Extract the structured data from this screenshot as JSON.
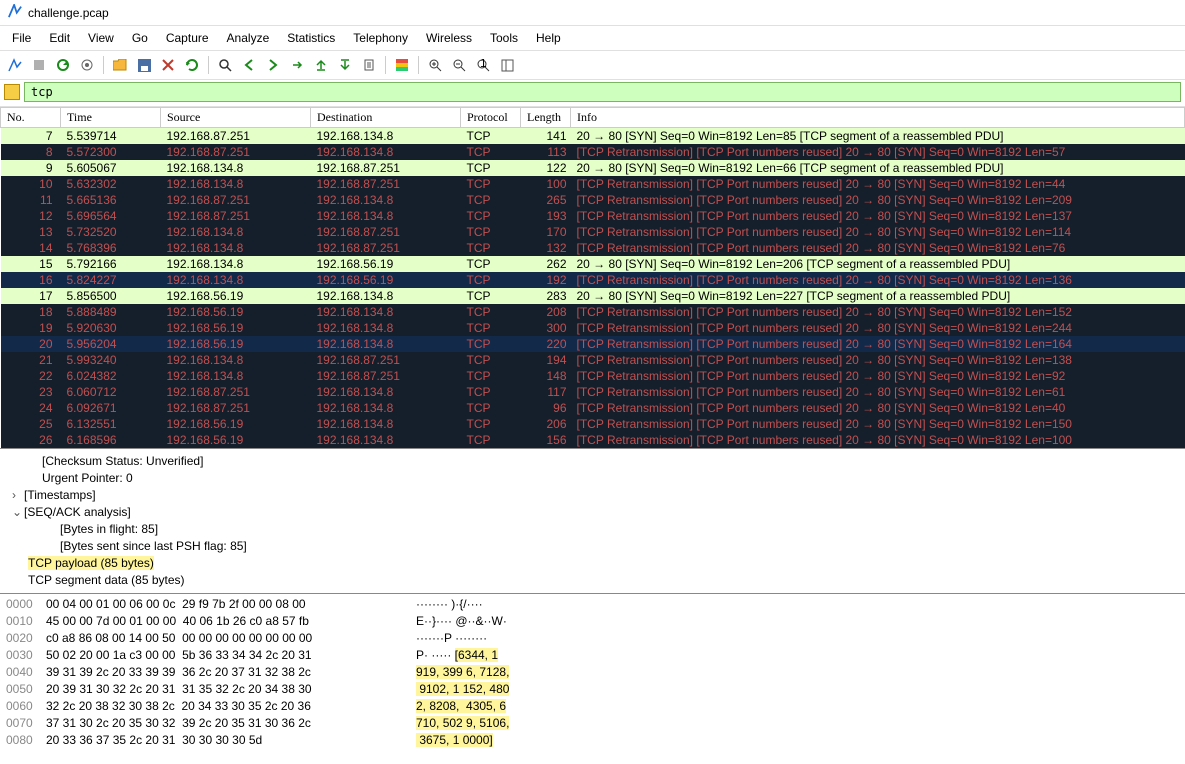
{
  "title": "challenge.pcap",
  "menus": [
    "File",
    "Edit",
    "View",
    "Go",
    "Capture",
    "Analyze",
    "Statistics",
    "Telephony",
    "Wireless",
    "Tools",
    "Help"
  ],
  "filter": "tcp",
  "columns": [
    "No.",
    "Time",
    "Source",
    "Destination",
    "Protocol",
    "Length",
    "Info"
  ],
  "packets": [
    {
      "no": 7,
      "time": "5.539714",
      "src": "192.168.87.251",
      "dst": "192.168.134.8",
      "proto": "TCP",
      "len": 141,
      "info": "20 → 80 [SYN] Seq=0 Win=8192 Len=85 [TCP segment of a reassembled PDU]",
      "cls": "r-ok"
    },
    {
      "no": 8,
      "time": "5.572300",
      "src": "192.168.87.251",
      "dst": "192.168.134.8",
      "proto": "TCP",
      "len": 113,
      "info": "[TCP Retransmission] [TCP Port numbers reused] 20 → 80 [SYN] Seq=0 Win=8192 Len=57",
      "cls": "r-bad"
    },
    {
      "no": 9,
      "time": "5.605067",
      "src": "192.168.134.8",
      "dst": "192.168.87.251",
      "proto": "TCP",
      "len": 122,
      "info": "20 → 80 [SYN] Seq=0 Win=8192 Len=66 [TCP segment of a reassembled PDU]",
      "cls": "r-ok"
    },
    {
      "no": 10,
      "time": "5.632302",
      "src": "192.168.134.8",
      "dst": "192.168.87.251",
      "proto": "TCP",
      "len": 100,
      "info": "[TCP Retransmission] [TCP Port numbers reused] 20 → 80 [SYN] Seq=0 Win=8192 Len=44",
      "cls": "r-bad"
    },
    {
      "no": 11,
      "time": "5.665136",
      "src": "192.168.87.251",
      "dst": "192.168.134.8",
      "proto": "TCP",
      "len": 265,
      "info": "[TCP Retransmission] [TCP Port numbers reused] 20 → 80 [SYN] Seq=0 Win=8192 Len=209",
      "cls": "r-bad"
    },
    {
      "no": 12,
      "time": "5.696564",
      "src": "192.168.87.251",
      "dst": "192.168.134.8",
      "proto": "TCP",
      "len": 193,
      "info": "[TCP Retransmission] [TCP Port numbers reused] 20 → 80 [SYN] Seq=0 Win=8192 Len=137",
      "cls": "r-bad"
    },
    {
      "no": 13,
      "time": "5.732520",
      "src": "192.168.134.8",
      "dst": "192.168.87.251",
      "proto": "TCP",
      "len": 170,
      "info": "[TCP Retransmission] [TCP Port numbers reused] 20 → 80 [SYN] Seq=0 Win=8192 Len=114",
      "cls": "r-bad"
    },
    {
      "no": 14,
      "time": "5.768396",
      "src": "192.168.134.8",
      "dst": "192.168.87.251",
      "proto": "TCP",
      "len": 132,
      "info": "[TCP Retransmission] [TCP Port numbers reused] 20 → 80 [SYN] Seq=0 Win=8192 Len=76",
      "cls": "r-bad"
    },
    {
      "no": 15,
      "time": "5.792166",
      "src": "192.168.134.8",
      "dst": "192.168.56.19",
      "proto": "TCP",
      "len": 262,
      "info": "20 → 80 [SYN] Seq=0 Win=8192 Len=206 [TCP segment of a reassembled PDU]",
      "cls": "r-ok"
    },
    {
      "no": 16,
      "time": "5.824227",
      "src": "192.168.134.8",
      "dst": "192.168.56.19",
      "proto": "TCP",
      "len": 192,
      "info": "[TCP Retransmission] [TCP Port numbers reused] 20 → 80 [SYN] Seq=0 Win=8192 Len=136",
      "cls": "r-badsel"
    },
    {
      "no": 17,
      "time": "5.856500",
      "src": "192.168.56.19",
      "dst": "192.168.134.8",
      "proto": "TCP",
      "len": 283,
      "info": "20 → 80 [SYN] Seq=0 Win=8192 Len=227 [TCP segment of a reassembled PDU]",
      "cls": "r-ok"
    },
    {
      "no": 18,
      "time": "5.888489",
      "src": "192.168.56.19",
      "dst": "192.168.134.8",
      "proto": "TCP",
      "len": 208,
      "info": "[TCP Retransmission] [TCP Port numbers reused] 20 → 80 [SYN] Seq=0 Win=8192 Len=152",
      "cls": "r-bad"
    },
    {
      "no": 19,
      "time": "5.920630",
      "src": "192.168.56.19",
      "dst": "192.168.134.8",
      "proto": "TCP",
      "len": 300,
      "info": "[TCP Retransmission] [TCP Port numbers reused] 20 → 80 [SYN] Seq=0 Win=8192 Len=244",
      "cls": "r-bad"
    },
    {
      "no": 20,
      "time": "5.956204",
      "src": "192.168.56.19",
      "dst": "192.168.134.8",
      "proto": "TCP",
      "len": 220,
      "info": "[TCP Retransmission] [TCP Port numbers reused] 20 → 80 [SYN] Seq=0 Win=8192 Len=164",
      "cls": "r-badsel"
    },
    {
      "no": 21,
      "time": "5.993240",
      "src": "192.168.134.8",
      "dst": "192.168.87.251",
      "proto": "TCP",
      "len": 194,
      "info": "[TCP Retransmission] [TCP Port numbers reused] 20 → 80 [SYN] Seq=0 Win=8192 Len=138",
      "cls": "r-bad"
    },
    {
      "no": 22,
      "time": "6.024382",
      "src": "192.168.134.8",
      "dst": "192.168.87.251",
      "proto": "TCP",
      "len": 148,
      "info": "[TCP Retransmission] [TCP Port numbers reused] 20 → 80 [SYN] Seq=0 Win=8192 Len=92",
      "cls": "r-bad"
    },
    {
      "no": 23,
      "time": "6.060712",
      "src": "192.168.87.251",
      "dst": "192.168.134.8",
      "proto": "TCP",
      "len": 117,
      "info": "[TCP Retransmission] [TCP Port numbers reused] 20 → 80 [SYN] Seq=0 Win=8192 Len=61",
      "cls": "r-bad"
    },
    {
      "no": 24,
      "time": "6.092671",
      "src": "192.168.87.251",
      "dst": "192.168.134.8",
      "proto": "TCP",
      "len": 96,
      "info": "[TCP Retransmission] [TCP Port numbers reused] 20 → 80 [SYN] Seq=0 Win=8192 Len=40",
      "cls": "r-bad"
    },
    {
      "no": 25,
      "time": "6.132551",
      "src": "192.168.56.19",
      "dst": "192.168.134.8",
      "proto": "TCP",
      "len": 206,
      "info": "[TCP Retransmission] [TCP Port numbers reused] 20 → 80 [SYN] Seq=0 Win=8192 Len=150",
      "cls": "r-bad"
    },
    {
      "no": 26,
      "time": "6.168596",
      "src": "192.168.56.19",
      "dst": "192.168.134.8",
      "proto": "TCP",
      "len": 156,
      "info": "[TCP Retransmission] [TCP Port numbers reused] 20 → 80 [SYN] Seq=0 Win=8192 Len=100",
      "cls": "r-bad"
    }
  ],
  "details": {
    "checksum": "[Checksum Status: Unverified]",
    "urgent": "Urgent Pointer: 0",
    "timestamps": "[Timestamps]",
    "seqack": "[SEQ/ACK analysis]",
    "bytes_in_flight": "[Bytes in flight: 85]",
    "bytes_since_psh": "[Bytes sent since last PSH flag: 85]",
    "tcp_payload": "TCP payload (85 bytes)",
    "segment_data": "TCP segment data (85 bytes)"
  },
  "hex": [
    {
      "off": "0000",
      "b": "00 04 00 01 00 06 00 0c  29 f9 7b 2f 00 00 08 00",
      "aplain": "········ )·{/····",
      "ay": ""
    },
    {
      "off": "0010",
      "b": "45 00 00 7d 00 01 00 00  40 06 1b 26 c0 a8 57 fb",
      "aplain": "E··}···· @··&··W·",
      "ay": ""
    },
    {
      "off": "0020",
      "b": "c0 a8 86 08 00 14 00 50  00 00 00 00 00 00 00 00",
      "aplain": "·······P ········",
      "ay": ""
    },
    {
      "off": "0030",
      "b": "50 02 20 00 1a c3 00 00  5b 36 33 34 34 2c 20 31",
      "aplain": "P· ····· ",
      "ay": "[6344, 1"
    },
    {
      "off": "0040",
      "b": "39 31 39 2c 20 33 39 39  36 2c 20 37 31 32 38 2c",
      "aplain": "",
      "ay": "919, 399 6, 7128,"
    },
    {
      "off": "0050",
      "b": "20 39 31 30 32 2c 20 31  31 35 32 2c 20 34 38 30",
      "aplain": "",
      "ay": " 9102, 1 152, 480"
    },
    {
      "off": "0060",
      "b": "32 2c 20 38 32 30 38 2c  20 34 33 30 35 2c 20 36",
      "aplain": "",
      "ay": "2, 8208,  4305, 6"
    },
    {
      "off": "0070",
      "b": "37 31 30 2c 20 35 30 32  39 2c 20 35 31 30 36 2c",
      "aplain": "",
      "ay": "710, 502 9, 5106,"
    },
    {
      "off": "0080",
      "b": "20 33 36 37 35 2c 20 31  30 30 30 30 5d",
      "aplain": "",
      "ay": " 3675, 1 0000]"
    }
  ],
  "icons": {
    "fin": "#1e6fd9",
    "folder": "#f6b73c",
    "save": "#555",
    "reload": "#1a8a1a",
    "find": "#333",
    "stop": "#c0392b"
  }
}
